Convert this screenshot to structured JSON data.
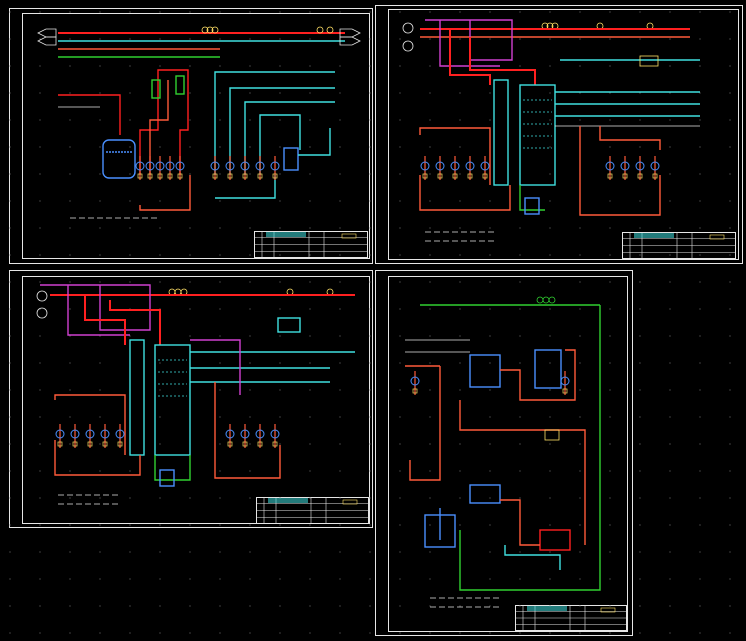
{
  "canvas": {
    "background": "#000000"
  },
  "colors": {
    "frame": "#e6e6e6",
    "steam": "#ff2020",
    "hot_water": "#ff5a3a",
    "cold_water": "#40e0e0",
    "condensate": "#30d030",
    "chemical": "#d040d0",
    "equipment": "#4a90ff",
    "instrument": "#ffe066",
    "dot_grid": "#6a6a6a"
  },
  "sheets": [
    {
      "id": "sheet-1",
      "title_block_text": "",
      "note_lines": 4
    },
    {
      "id": "sheet-2",
      "title_block_text": "",
      "note_lines": 5
    },
    {
      "id": "sheet-3",
      "title_block_text": "",
      "note_lines": 3
    },
    {
      "id": "sheet-4",
      "title_block_text": "",
      "note_lines": 3
    }
  ]
}
